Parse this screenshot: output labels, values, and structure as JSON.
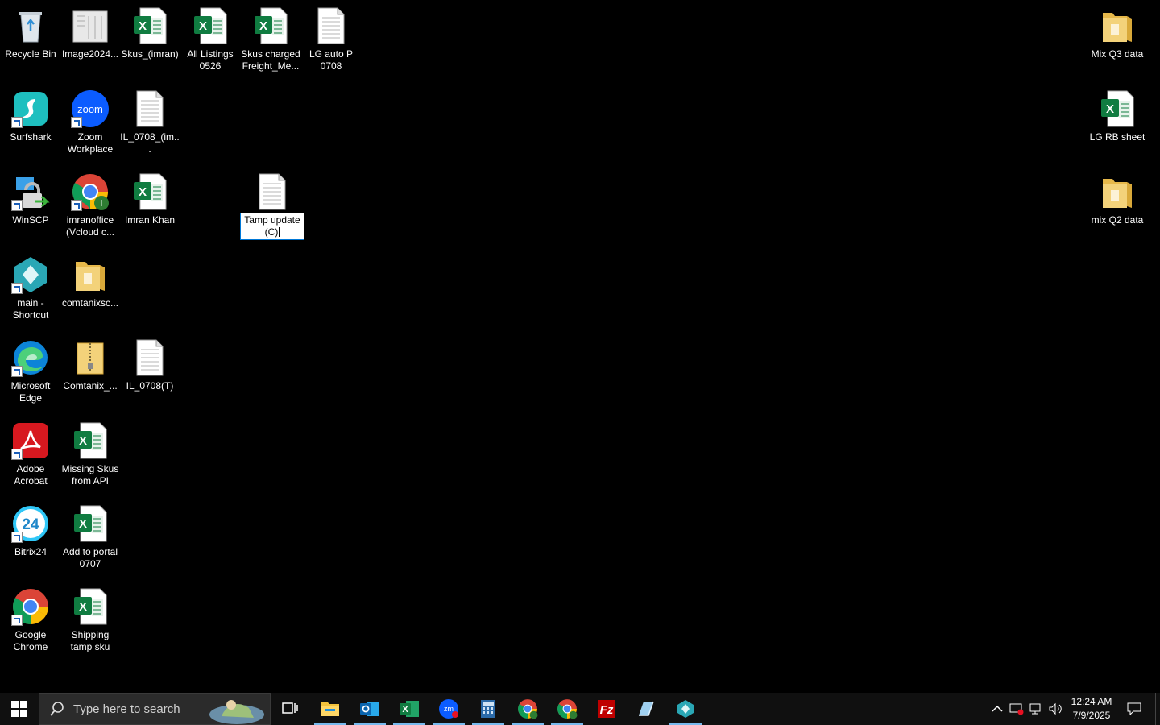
{
  "desktop": {
    "icons": [
      {
        "label": "Recycle Bin"
      },
      {
        "label": "Image2024..."
      },
      {
        "label": "Skus_(imran)"
      },
      {
        "label": "All Listings 0526"
      },
      {
        "label": "Skus charged Freight_Me..."
      },
      {
        "label": "LG auto P 0708"
      },
      {
        "label": "Surfshark"
      },
      {
        "label": "Zoom Workplace"
      },
      {
        "label": "IL_0708_(im..."
      },
      {
        "label": "WinSCP"
      },
      {
        "label": "imranoffice (Vcloud c..."
      },
      {
        "label": "Imran Khan"
      },
      {
        "label": "Tamp update (C)"
      },
      {
        "label": "main - Shortcut"
      },
      {
        "label": "comtanixsc..."
      },
      {
        "label": "Microsoft Edge"
      },
      {
        "label": "Comtanix_..."
      },
      {
        "label": "IL_0708(T)"
      },
      {
        "label": "Adobe Acrobat"
      },
      {
        "label": "Missing Skus from API"
      },
      {
        "label": "Bitrix24"
      },
      {
        "label": "Add to portal 0707"
      },
      {
        "label": "Google Chrome"
      },
      {
        "label": "Shipping tamp sku"
      },
      {
        "label": "Mix Q3 data"
      },
      {
        "label": "LG RB sheet"
      },
      {
        "label": "mix Q2 data"
      }
    ],
    "rename_value": "Tamp update (C)"
  },
  "taskbar": {
    "search_placeholder": "Type here to search",
    "apps": [
      {
        "name": "file-explorer-icon",
        "active": true
      },
      {
        "name": "outlook-icon",
        "active": true
      },
      {
        "name": "excel-icon",
        "active": true
      },
      {
        "name": "zoom-icon",
        "active": true
      },
      {
        "name": "calculator-icon",
        "active": true
      },
      {
        "name": "chrome-icon",
        "active": true
      },
      {
        "name": "chrome-profile-icon",
        "active": true
      },
      {
        "name": "filezilla-icon",
        "active": false
      },
      {
        "name": "app-icon",
        "active": false
      },
      {
        "name": "main-app-icon",
        "active": true
      }
    ],
    "clock": {
      "time": "12:24 AM",
      "date": "7/9/2025"
    }
  },
  "colors": {
    "excel": "#107c41",
    "folder": "#f3d27a",
    "zoom": "#0b5cff",
    "accent": "#76b9ed"
  }
}
